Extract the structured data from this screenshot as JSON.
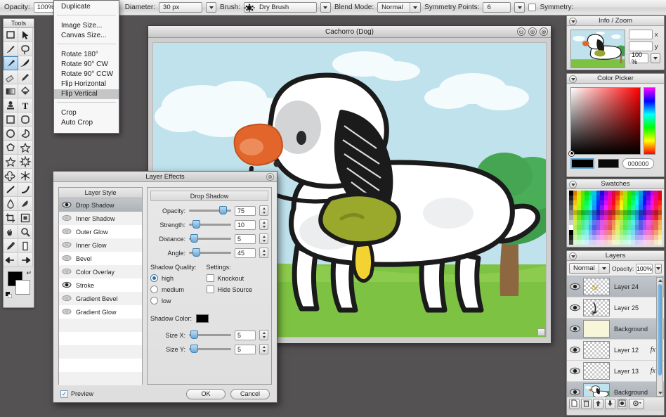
{
  "topbar": {
    "opacity_label": "Opacity:",
    "opacity_value": "100%",
    "diameter_label": "Diameter:",
    "diameter_value": "30 px",
    "brush_label": "Brush:",
    "brush_value": "Dry Brush",
    "blend_label": "Blend Mode:",
    "blend_value": "Normal",
    "symmetry_points_label": "Symmetry Points:",
    "symmetry_points_value": "6",
    "symmetry_label": "Symmetry:"
  },
  "menu": {
    "groups": [
      [
        "Duplicate"
      ],
      [
        "Image Size...",
        "Canvas Size..."
      ],
      [
        "Rotate 180°",
        "Rotate 90° CW",
        "Rotate 90° CCW",
        "Flip Horizontal",
        "Flip Vertical"
      ],
      [
        "Crop",
        "Auto Crop"
      ]
    ],
    "selected": "Flip Vertical"
  },
  "tools": {
    "title": "Tools",
    "items": [
      {
        "name": "rectangle-select-tool",
        "glyph": "rect-select"
      },
      {
        "name": "move-tool",
        "glyph": "pointer"
      },
      {
        "name": "pen-tool",
        "glyph": "pen"
      },
      {
        "name": "lasso-tool",
        "glyph": "lasso"
      },
      {
        "name": "brush-tool",
        "glyph": "brush"
      },
      {
        "name": "paintbrush-tool",
        "glyph": "paintbrush"
      },
      {
        "name": "eraser-tool",
        "glyph": "eraser"
      },
      {
        "name": "pencil-tool",
        "glyph": "pencil"
      },
      {
        "name": "gradient-tool",
        "glyph": "gradient"
      },
      {
        "name": "paint-bucket-tool",
        "glyph": "bucket"
      },
      {
        "name": "clone-stamp-tool",
        "glyph": "stamp"
      },
      {
        "name": "text-tool",
        "glyph": "text"
      },
      {
        "name": "rectangle-shape-tool",
        "glyph": "square"
      },
      {
        "name": "rounded-rect-tool",
        "glyph": "roundrect"
      },
      {
        "name": "ellipse-tool",
        "glyph": "circle"
      },
      {
        "name": "pie-shape-tool",
        "glyph": "pie"
      },
      {
        "name": "polygon-tool",
        "glyph": "polygon"
      },
      {
        "name": "star-tool",
        "glyph": "star"
      },
      {
        "name": "star5-tool",
        "glyph": "star5"
      },
      {
        "name": "star-burst-tool",
        "glyph": "starburst"
      },
      {
        "name": "flower-tool",
        "glyph": "flower"
      },
      {
        "name": "snowflake-tool",
        "glyph": "snowflake"
      },
      {
        "name": "line-tool",
        "glyph": "line"
      },
      {
        "name": "curve-tool",
        "glyph": "curve"
      },
      {
        "name": "blur-tool",
        "glyph": "drop"
      },
      {
        "name": "smudge-tool",
        "glyph": "smudge"
      },
      {
        "name": "crop-tool",
        "glyph": "crop"
      },
      {
        "name": "frame-tool",
        "glyph": "frame"
      },
      {
        "name": "hand-tool",
        "glyph": "hand"
      },
      {
        "name": "zoom-tool",
        "glyph": "magnifier"
      },
      {
        "name": "eyedropper-tool",
        "glyph": "dropper"
      },
      {
        "name": "column-tool",
        "glyph": "column"
      },
      {
        "name": "arrow-left-tool",
        "glyph": "arrowleft"
      },
      {
        "name": "arrow-right-tool",
        "glyph": "arrowright"
      }
    ],
    "active_index": 4,
    "foreground_color": "#000000",
    "background_color": "#ffffff"
  },
  "canvas_window": {
    "title": "Cachorro (Dog)",
    "minimize": "⊖",
    "maximize": "⊕",
    "close": "⊗"
  },
  "artwork": {
    "sky_color": "#bfe2ec",
    "grass_color": "#7dc242",
    "cloud_color": "#f4fbfc",
    "dog_body_color": "#ffffff",
    "dog_outline_color": "#1b1b1b",
    "nose_color": "#e2662b",
    "collar_color": "#9aa92b",
    "tag_color": "#f2d332",
    "tree_foliage_color": "#3f9e4d",
    "tree_trunk_color": "#9c7347"
  },
  "info_zoom": {
    "title": "Info / Zoom",
    "x_label": "x",
    "y_label": "y",
    "x_value": "",
    "y_value": "",
    "zoom_value": "100 %"
  },
  "color_picker": {
    "title": "Color Picker",
    "hex_value": "000000",
    "foreground": "#000000",
    "background": "#0a0a0a"
  },
  "swatches": {
    "title": "Swatches"
  },
  "layers_panel": {
    "title": "Layers",
    "blend_mode": "Normal",
    "opacity_label": "Opacity:",
    "opacity_value": "100%",
    "rows": [
      {
        "name": "Background",
        "selected": true,
        "thumb": "artwork",
        "fx": false
      },
      {
        "name": "Layer 13",
        "selected": false,
        "thumb": "empty",
        "fx": true
      },
      {
        "name": "Layer 12",
        "selected": false,
        "thumb": "empty",
        "fx": true
      },
      {
        "name": "Background",
        "selected": true,
        "thumb": "cream",
        "fx": false
      },
      {
        "name": "Layer 25",
        "selected": false,
        "thumb": "scribble",
        "fx": false
      },
      {
        "name": "Layer 24",
        "selected": true,
        "thumb": "dots",
        "fx": false
      }
    ],
    "footer_buttons": [
      {
        "name": "new-layer-button",
        "glyph": "page"
      },
      {
        "name": "delete-layer-button",
        "glyph": "trash"
      },
      {
        "name": "move-layer-up-button",
        "glyph": "up"
      },
      {
        "name": "move-layer-down-button",
        "glyph": "down"
      },
      {
        "name": "layer-mask-button",
        "glyph": "mask"
      },
      {
        "name": "layer-settings-button",
        "glyph": "gear"
      }
    ]
  },
  "dialog": {
    "title": "Layer Effects",
    "close_glyph": "⊗",
    "style_column_title": "Layer Style",
    "styles": [
      {
        "label": "Drop Shadow",
        "selected": true,
        "enabled": true
      },
      {
        "label": "Inner Shadow",
        "selected": false,
        "enabled": false
      },
      {
        "label": "Outer Glow",
        "selected": false,
        "enabled": false
      },
      {
        "label": "Inner Glow",
        "selected": false,
        "enabled": false
      },
      {
        "label": "Bevel",
        "selected": false,
        "enabled": false
      },
      {
        "label": "Color Overlay",
        "selected": false,
        "enabled": false
      },
      {
        "label": "Stroke",
        "selected": false,
        "enabled": true
      },
      {
        "label": "Gradient Bevel",
        "selected": false,
        "enabled": false
      },
      {
        "label": "Gradient Glow",
        "selected": false,
        "enabled": false
      }
    ],
    "effect_title": "Drop Shadow",
    "sliders": [
      {
        "label": "Opacity:",
        "value": "75",
        "pct": 72
      },
      {
        "label": "Strength:",
        "value": "10",
        "pct": 8
      },
      {
        "label": "Distance:",
        "value": "5",
        "pct": 3
      },
      {
        "label": "Angle:",
        "value": "45",
        "pct": 8
      }
    ],
    "shadow_quality_title": "Shadow Quality:",
    "shadow_quality_options": [
      "high",
      "medium",
      "low"
    ],
    "shadow_quality_selected": "high",
    "settings_title": "Settings:",
    "settings_options": [
      {
        "label": "Knockout",
        "checked": false
      },
      {
        "label": "Hide Source",
        "checked": false
      }
    ],
    "shadow_color_label": "Shadow Color:",
    "shadow_color": "#000000",
    "size_sliders": [
      {
        "label": "Size X:",
        "value": "5",
        "pct": 3
      },
      {
        "label": "Size Y:",
        "value": "5",
        "pct": 3
      }
    ],
    "preview_label": "Preview",
    "preview_checked": true,
    "ok_label": "OK",
    "cancel_label": "Cancel"
  }
}
